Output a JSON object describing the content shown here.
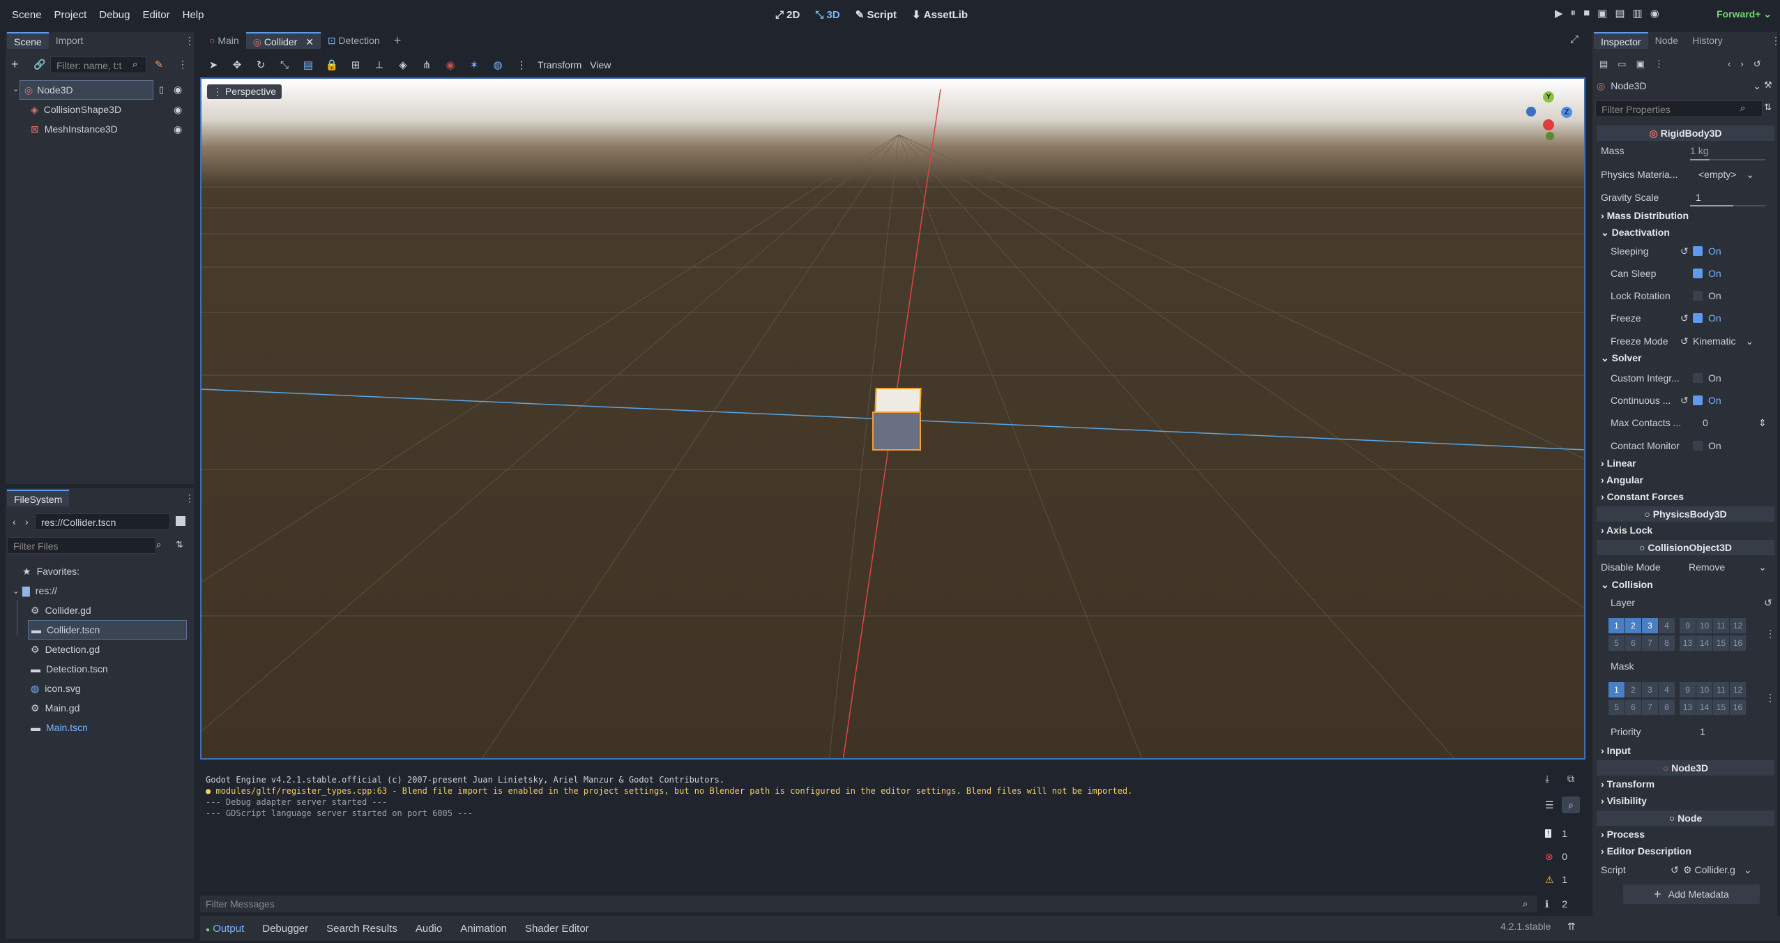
{
  "menu": [
    "Scene",
    "Project",
    "Debug",
    "Editor",
    "Help"
  ],
  "modes": {
    "m2d": "2D",
    "m3d": "3D",
    "script": "Script",
    "assetlib": "AssetLib"
  },
  "renderer": "Forward+",
  "scene_dock": {
    "tabs": [
      "Scene",
      "Import"
    ],
    "filter_placeholder": "Filter: name, t:t",
    "nodes": [
      "Node3D",
      "CollisionShape3D",
      "MeshInstance3D"
    ]
  },
  "filesystem": {
    "tab": "FileSystem",
    "path": "res://Collider.tscn",
    "filter_placeholder": "Filter Files",
    "favorites": "Favorites:",
    "root": "res://",
    "files": [
      "Collider.gd",
      "Collider.tscn",
      "Detection.gd",
      "Detection.tscn",
      "icon.svg",
      "Main.gd",
      "Main.tscn"
    ]
  },
  "editor_tabs": [
    "Main",
    "Collider",
    "Detection"
  ],
  "viewport": {
    "menus": [
      "Transform",
      "View"
    ],
    "perspective": "Perspective",
    "gizmo": {
      "y": "Y",
      "z": "Z"
    }
  },
  "console": {
    "lines": [
      "Godot Engine v4.2.1.stable.official (c) 2007-present Juan Linietsky, Ariel Manzur & Godot Contributors.",
      "modules/gltf/register_types.cpp:63 - Blend file import is enabled in the project settings, but no Blender path is configured in the editor settings. Blend files will not be imported.",
      "--- Debug adapter server started ---",
      "--- GDScript language server started on port 6005 ---"
    ],
    "filter_placeholder": "Filter Messages",
    "counts": [
      "1",
      "0",
      "1",
      "2"
    ]
  },
  "bottom_tabs": [
    "Output",
    "Debugger",
    "Search Results",
    "Audio",
    "Animation",
    "Shader Editor"
  ],
  "version": "4.2.1.stable",
  "inspector": {
    "tabs": [
      "Inspector",
      "Node",
      "History"
    ],
    "node": "Node3D",
    "filter_placeholder": "Filter Properties",
    "class": "RigidBody3D",
    "mass_label": "Mass",
    "mass_value": "1",
    "mass_unit": "kg",
    "phys_mat_label": "Physics Materia...",
    "phys_mat_value": "<empty>",
    "gravity_label": "Gravity Scale",
    "gravity_value": "1",
    "mass_dist": "Mass Distribution",
    "deactivation": "Deactivation",
    "sleeping": "Sleeping",
    "can_sleep": "Can Sleep",
    "lock_rotation": "Lock Rotation",
    "freeze": "Freeze",
    "freeze_mode": "Freeze Mode",
    "freeze_mode_value": "Kinematic",
    "on": "On",
    "solver": "Solver",
    "custom_integ": "Custom Integr...",
    "continuous": "Continuous ...",
    "max_contacts": "Max Contacts ...",
    "max_contacts_value": "0",
    "contact_monitor": "Contact Monitor",
    "linear": "Linear",
    "angular": "Angular",
    "constant_forces": "Constant Forces",
    "physicsbody": "PhysicsBody3D",
    "axis_lock": "Axis Lock",
    "collisionobject": "CollisionObject3D",
    "disable_mode": "Disable Mode",
    "disable_mode_value": "Remove",
    "collision": "Collision",
    "layer": "Layer",
    "mask": "Mask",
    "grid_top": [
      "1",
      "2",
      "3",
      "4",
      "9",
      "10",
      "11",
      "12"
    ],
    "grid_bottom": [
      "5",
      "6",
      "7",
      "8",
      "13",
      "14",
      "15",
      "16"
    ],
    "priority": "Priority",
    "priority_value": "1",
    "input": "Input",
    "node3d": "Node3D",
    "transform": "Transform",
    "visibility": "Visibility",
    "node_section": "Node",
    "process": "Process",
    "editor_desc": "Editor Description",
    "script": "Script",
    "script_value": "Collider.g",
    "add_metadata": "Add Metadata"
  }
}
